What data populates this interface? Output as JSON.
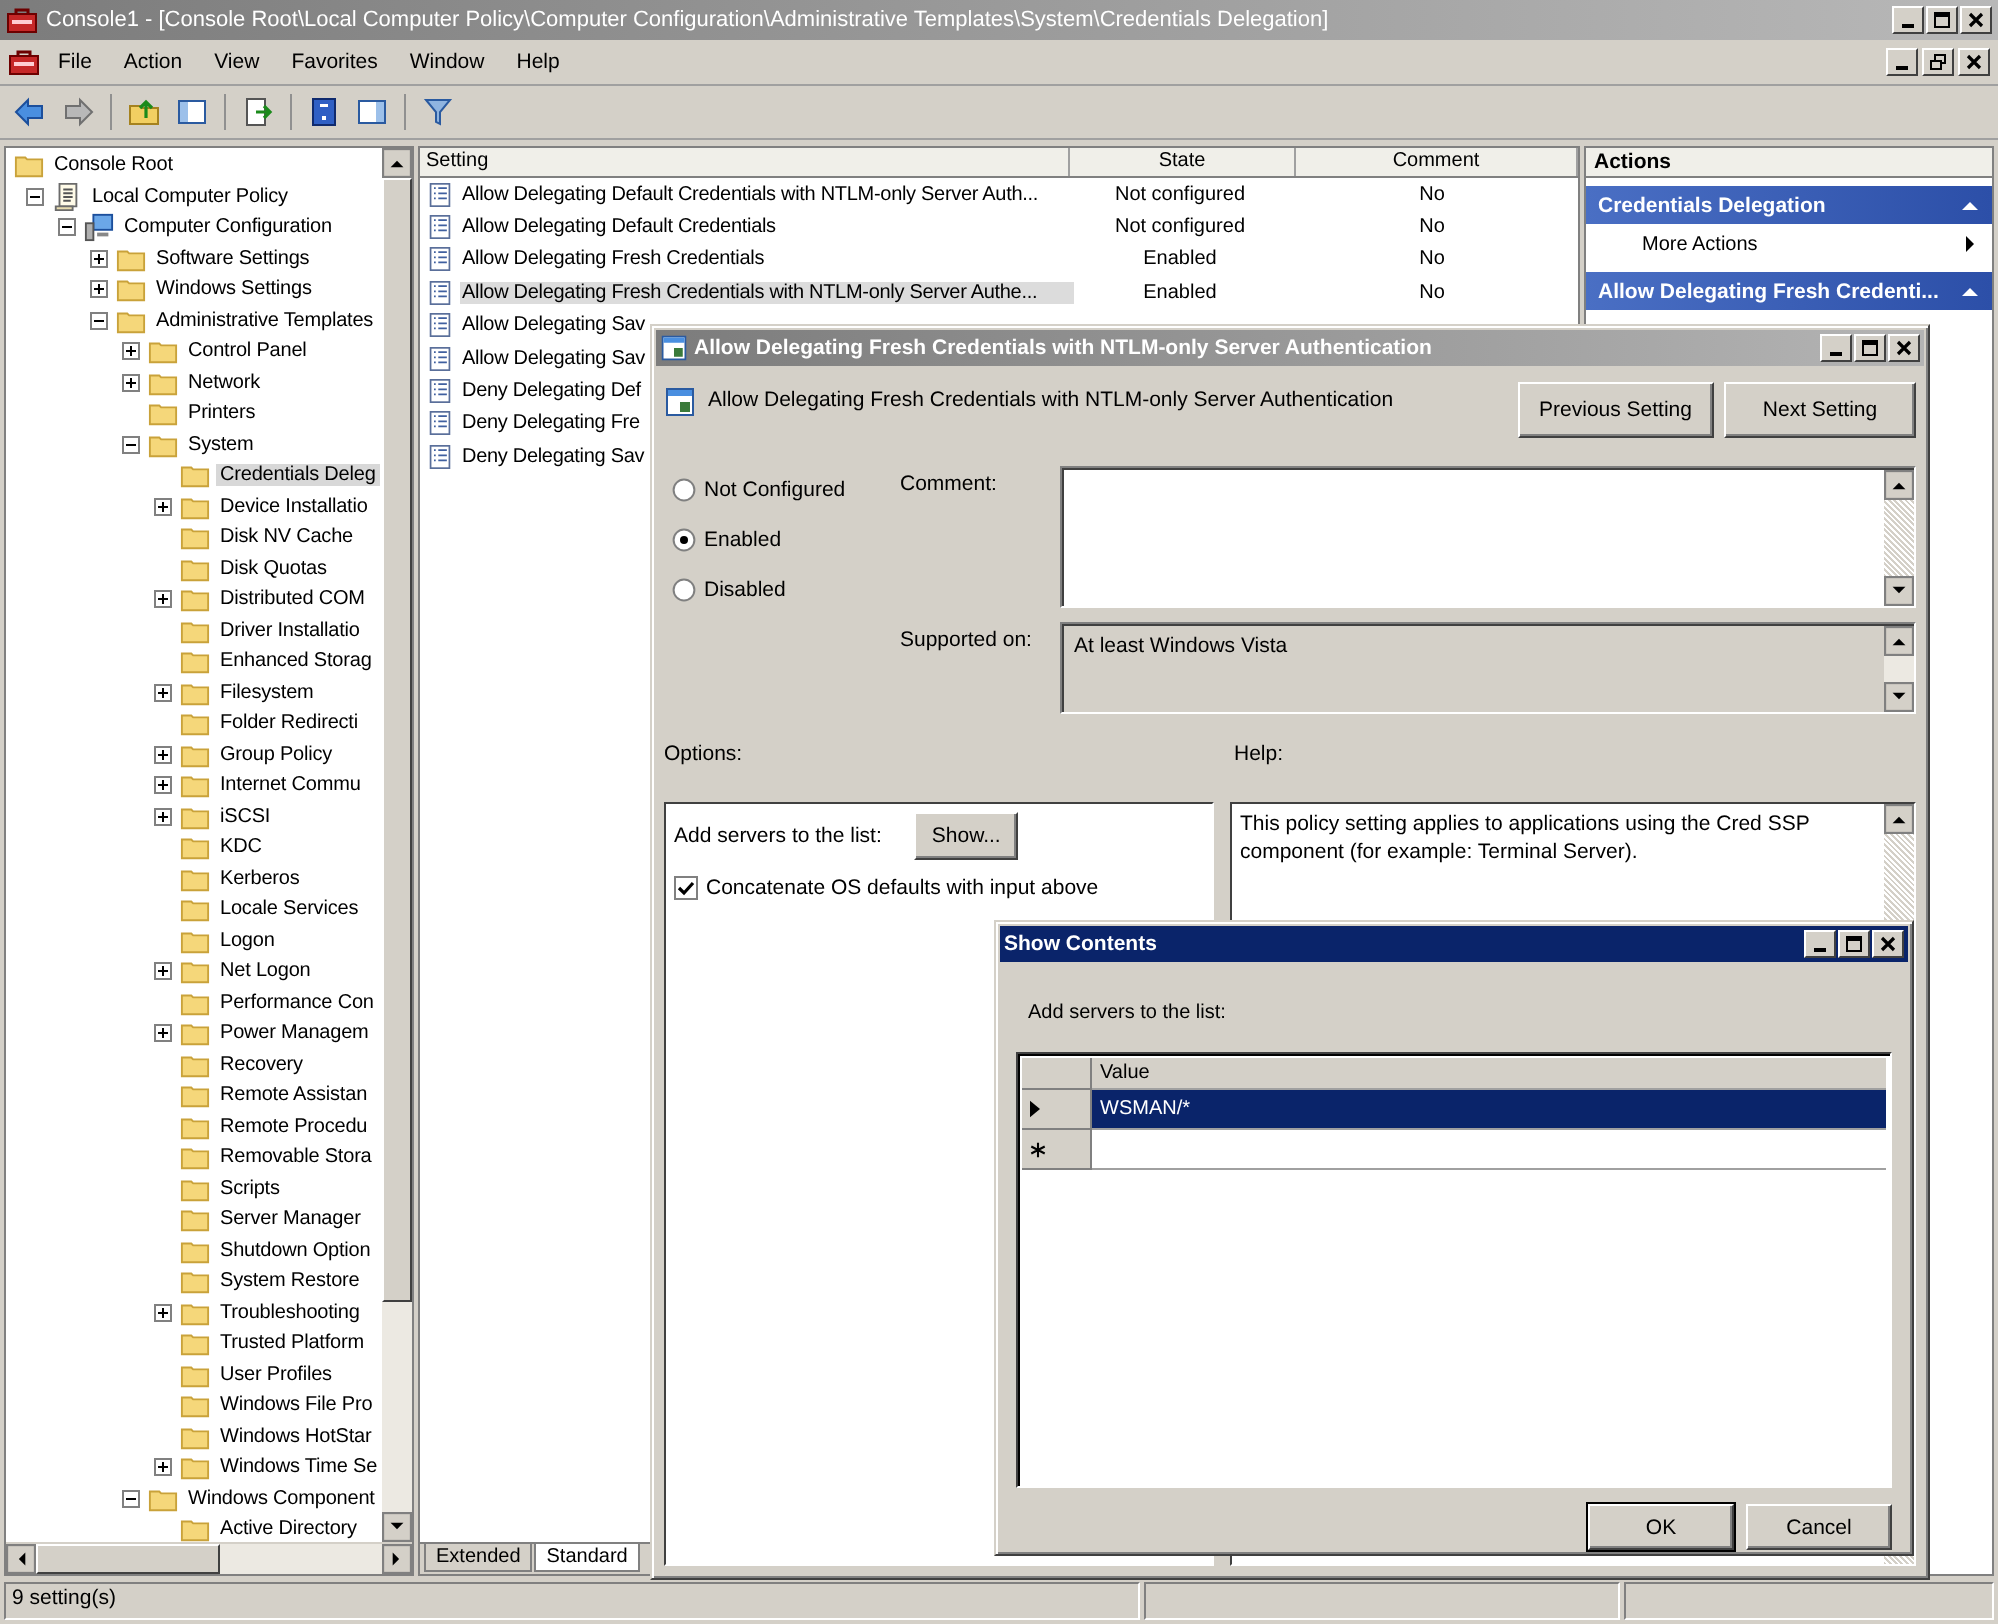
{
  "window": {
    "title": "Console1 - [Console Root\\Local Computer Policy\\Computer Configuration\\Administrative Templates\\System\\Credentials Delegation]"
  },
  "menu": [
    "File",
    "Action",
    "View",
    "Favorites",
    "Window",
    "Help"
  ],
  "tree": [
    {
      "label": "Console Root",
      "kind": "folder",
      "selected": false,
      "children": [
        {
          "label": "Local Computer Policy",
          "kind": "policy",
          "expanded": true,
          "selected": false,
          "children": [
            {
              "label": "Computer Configuration",
              "kind": "computer",
              "expanded": true,
              "selected": false,
              "children": [
                {
                  "label": "Software Settings",
                  "kind": "folder",
                  "expanded": false,
                  "selected": false
                },
                {
                  "label": "Windows Settings",
                  "kind": "folder",
                  "expanded": false,
                  "selected": false
                },
                {
                  "label": "Administrative Templates",
                  "kind": "folder",
                  "expanded": true,
                  "selected": false,
                  "children": [
                    {
                      "label": "Control Panel",
                      "kind": "folder",
                      "expanded": false,
                      "selected": false
                    },
                    {
                      "label": "Network",
                      "kind": "folder",
                      "expanded": false,
                      "selected": false
                    },
                    {
                      "label": "Printers",
                      "kind": "folder",
                      "selected": false
                    },
                    {
                      "label": "System",
                      "kind": "folder",
                      "expanded": true,
                      "selected": false,
                      "children": [
                        {
                          "label": "Credentials Deleg",
                          "kind": "folder",
                          "selected": true
                        },
                        {
                          "label": "Device Installatio",
                          "kind": "folder",
                          "expanded": false,
                          "selected": false
                        },
                        {
                          "label": "Disk NV Cache",
                          "kind": "folder",
                          "selected": false
                        },
                        {
                          "label": "Disk Quotas",
                          "kind": "folder",
                          "selected": false
                        },
                        {
                          "label": "Distributed COM",
                          "kind": "folder",
                          "expanded": false,
                          "selected": false
                        },
                        {
                          "label": "Driver Installatio",
                          "kind": "folder",
                          "selected": false
                        },
                        {
                          "label": "Enhanced Storag",
                          "kind": "folder",
                          "selected": false
                        },
                        {
                          "label": "Filesystem",
                          "kind": "folder",
                          "expanded": false,
                          "selected": false
                        },
                        {
                          "label": "Folder Redirecti",
                          "kind": "folder",
                          "selected": false
                        },
                        {
                          "label": "Group Policy",
                          "kind": "folder",
                          "expanded": false,
                          "selected": false
                        },
                        {
                          "label": "Internet Commu",
                          "kind": "folder",
                          "expanded": false,
                          "selected": false
                        },
                        {
                          "label": "iSCSI",
                          "kind": "folder",
                          "expanded": false,
                          "selected": false
                        },
                        {
                          "label": "KDC",
                          "kind": "folder",
                          "selected": false
                        },
                        {
                          "label": "Kerberos",
                          "kind": "folder",
                          "selected": false
                        },
                        {
                          "label": "Locale Services",
                          "kind": "folder",
                          "selected": false
                        },
                        {
                          "label": "Logon",
                          "kind": "folder",
                          "selected": false
                        },
                        {
                          "label": "Net Logon",
                          "kind": "folder",
                          "expanded": false,
                          "selected": false
                        },
                        {
                          "label": "Performance Con",
                          "kind": "folder",
                          "selected": false
                        },
                        {
                          "label": "Power Managem",
                          "kind": "folder",
                          "expanded": false,
                          "selected": false
                        },
                        {
                          "label": "Recovery",
                          "kind": "folder",
                          "selected": false
                        },
                        {
                          "label": "Remote Assistan",
                          "kind": "folder",
                          "selected": false
                        },
                        {
                          "label": "Remote Procedu",
                          "kind": "folder",
                          "selected": false
                        },
                        {
                          "label": "Removable Stora",
                          "kind": "folder",
                          "selected": false
                        },
                        {
                          "label": "Scripts",
                          "kind": "folder",
                          "selected": false
                        },
                        {
                          "label": "Server Manager",
                          "kind": "folder",
                          "selected": false
                        },
                        {
                          "label": "Shutdown Option",
                          "kind": "folder",
                          "selected": false
                        },
                        {
                          "label": "System Restore",
                          "kind": "folder",
                          "selected": false
                        },
                        {
                          "label": "Troubleshooting",
                          "kind": "folder",
                          "expanded": false,
                          "selected": false
                        },
                        {
                          "label": "Trusted Platform",
                          "kind": "folder",
                          "selected": false
                        },
                        {
                          "label": "User Profiles",
                          "kind": "folder",
                          "selected": false
                        },
                        {
                          "label": "Windows File Pro",
                          "kind": "folder",
                          "selected": false
                        },
                        {
                          "label": "Windows HotStar",
                          "kind": "folder",
                          "selected": false
                        },
                        {
                          "label": "Windows Time Se",
                          "kind": "folder",
                          "expanded": false,
                          "selected": false
                        }
                      ]
                    },
                    {
                      "label": "Windows Component",
                      "kind": "folder",
                      "expanded": true,
                      "selected": false,
                      "children": [
                        {
                          "label": "Active Directory",
                          "kind": "folder",
                          "selected": false
                        }
                      ]
                    }
                  ]
                }
              ]
            }
          ]
        }
      ]
    }
  ],
  "settings_list": {
    "columns": [
      "Setting",
      "State",
      "Comment"
    ],
    "rows": [
      {
        "setting": "Allow Delegating Default Credentials with NTLM-only Server Auth...",
        "state": "Not configured",
        "comment": "No",
        "selected": false
      },
      {
        "setting": "Allow Delegating Default Credentials",
        "state": "Not configured",
        "comment": "No",
        "selected": false
      },
      {
        "setting": "Allow Delegating Fresh Credentials",
        "state": "Enabled",
        "comment": "No",
        "selected": false
      },
      {
        "setting": "Allow Delegating Fresh Credentials with NTLM-only Server Authe...",
        "state": "Enabled",
        "comment": "No",
        "selected": true
      },
      {
        "setting": "Allow Delegating Sav",
        "selected": false
      },
      {
        "setting": "Allow Delegating Sav",
        "selected": false
      },
      {
        "setting": "Deny Delegating Def",
        "selected": false
      },
      {
        "setting": "Deny Delegating Fre",
        "selected": false
      },
      {
        "setting": "Deny Delegating Sav",
        "selected": false
      }
    ]
  },
  "view_tabs": [
    {
      "label": "Extended",
      "selected": false
    },
    {
      "label": "Standard",
      "selected": true
    }
  ],
  "actions": {
    "title": "Actions",
    "sections": [
      {
        "header": "Credentials Delegation",
        "items": [
          "More Actions"
        ]
      },
      {
        "header": "Allow Delegating Fresh Credenti..."
      }
    ]
  },
  "status_bar": "9 setting(s)",
  "policy_dialog": {
    "title": "Allow Delegating Fresh Credentials with NTLM-only Server Authentication",
    "heading": "Allow Delegating Fresh Credentials with NTLM-only Server Authentication",
    "buttons": [
      "Previous Setting",
      "Next Setting"
    ],
    "options": [
      {
        "label": "Not Configured",
        "selected": false
      },
      {
        "label": "Enabled",
        "selected": true
      },
      {
        "label": "Disabled",
        "selected": false
      }
    ],
    "comment_label": "Comment:",
    "supported_label": "Supported on:",
    "supported_value": "At least Windows Vista",
    "options_label": "Options:",
    "help_label": "Help:",
    "add_servers_label": "Add servers to the list:",
    "show_button": "Show...",
    "concatenate": {
      "label": "Concatenate OS defaults with input above",
      "checked": true
    },
    "help_text": "This policy setting applies to applications using the Cred SSP component (for example: Terminal Server)."
  },
  "show_contents": {
    "title": "Show Contents",
    "label": "Add servers to the list:",
    "column": "Value",
    "rows": [
      {
        "value": "WSMAN/*",
        "selected": true
      }
    ],
    "buttons": [
      "OK",
      "Cancel"
    ]
  }
}
